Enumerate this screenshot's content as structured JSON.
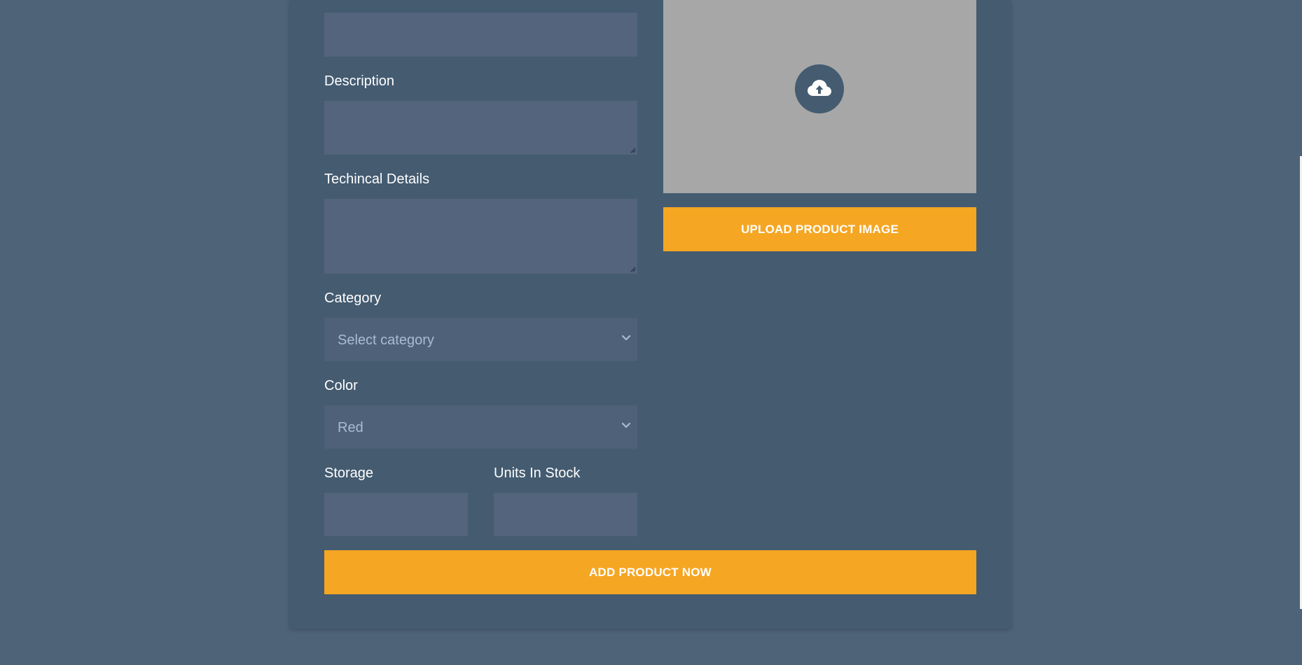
{
  "form": {
    "description_label": "Description",
    "technical_label": "Techincal Details",
    "category_label": "Category",
    "category_value": "Select category",
    "color_label": "Color",
    "color_value": "Red",
    "storage_label": "Storage",
    "units_label": "Units In Stock",
    "submit_label": "ADD PRODUCT NOW"
  },
  "upload": {
    "icon": "cloud-upload-icon",
    "button_label": "UPLOAD PRODUCT IMAGE"
  },
  "colors": {
    "page_bg": "#4f6378",
    "card_bg": "#445b70",
    "field_bg": "#53647c",
    "accent": "#f5a623",
    "image_placeholder": "#a7a7a7"
  }
}
